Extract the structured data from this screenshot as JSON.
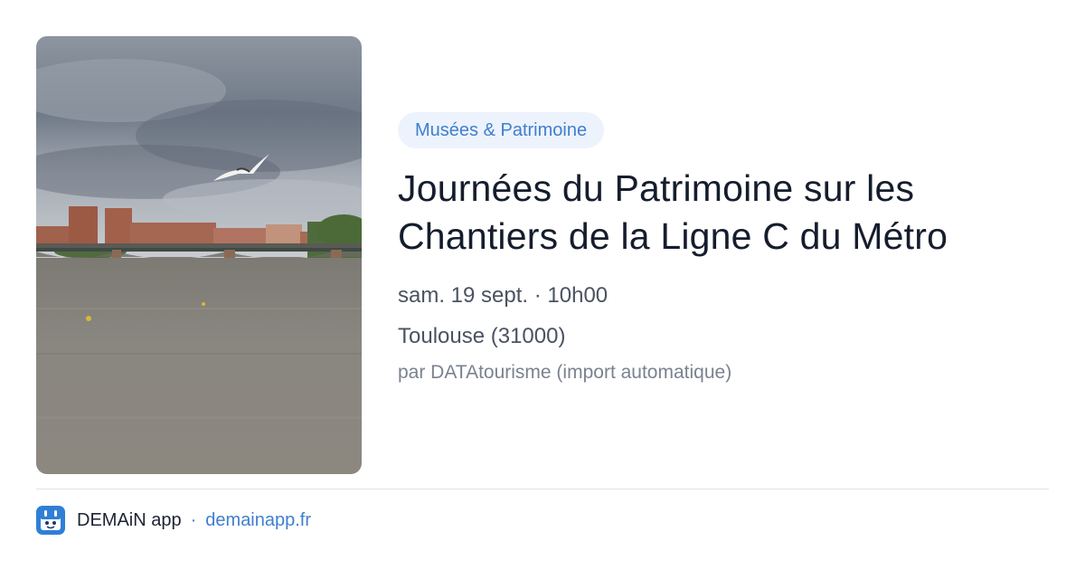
{
  "event": {
    "category": "Musées & Patrimoine",
    "title_line1": "Journées du Patrimoine sur les",
    "title_line2": "Chantiers de la Ligne C du Métro",
    "datetime": "sam. 19 sept. · 10h00",
    "location": "Toulouse (31000)",
    "source": "par DATAtourisme (import automatique)",
    "image_icon": "river-bridge-photo"
  },
  "footer": {
    "app_name": "DEMAiN app",
    "separator": "·",
    "url": "demainapp.fr",
    "logo_icon": "demain-logo-icon"
  },
  "colors": {
    "accent": "#3f7fcf",
    "badge_bg": "#edf3fc",
    "title": "#151d2d",
    "meta": "#4b5261",
    "muted": "#7a8290"
  }
}
